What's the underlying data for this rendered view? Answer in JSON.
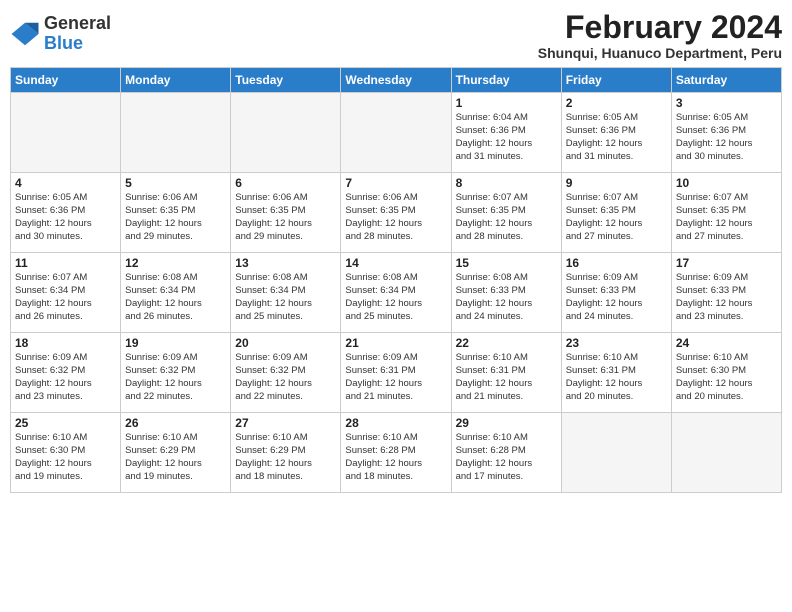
{
  "logo": {
    "general": "General",
    "blue": "Blue"
  },
  "title": {
    "month_year": "February 2024",
    "location": "Shunqui, Huanuco Department, Peru"
  },
  "headers": [
    "Sunday",
    "Monday",
    "Tuesday",
    "Wednesday",
    "Thursday",
    "Friday",
    "Saturday"
  ],
  "weeks": [
    [
      {
        "day": "",
        "lines": []
      },
      {
        "day": "",
        "lines": []
      },
      {
        "day": "",
        "lines": []
      },
      {
        "day": "",
        "lines": []
      },
      {
        "day": "1",
        "lines": [
          "Sunrise: 6:04 AM",
          "Sunset: 6:36 PM",
          "Daylight: 12 hours",
          "and 31 minutes."
        ]
      },
      {
        "day": "2",
        "lines": [
          "Sunrise: 6:05 AM",
          "Sunset: 6:36 PM",
          "Daylight: 12 hours",
          "and 31 minutes."
        ]
      },
      {
        "day": "3",
        "lines": [
          "Sunrise: 6:05 AM",
          "Sunset: 6:36 PM",
          "Daylight: 12 hours",
          "and 30 minutes."
        ]
      }
    ],
    [
      {
        "day": "4",
        "lines": [
          "Sunrise: 6:05 AM",
          "Sunset: 6:36 PM",
          "Daylight: 12 hours",
          "and 30 minutes."
        ]
      },
      {
        "day": "5",
        "lines": [
          "Sunrise: 6:06 AM",
          "Sunset: 6:35 PM",
          "Daylight: 12 hours",
          "and 29 minutes."
        ]
      },
      {
        "day": "6",
        "lines": [
          "Sunrise: 6:06 AM",
          "Sunset: 6:35 PM",
          "Daylight: 12 hours",
          "and 29 minutes."
        ]
      },
      {
        "day": "7",
        "lines": [
          "Sunrise: 6:06 AM",
          "Sunset: 6:35 PM",
          "Daylight: 12 hours",
          "and 28 minutes."
        ]
      },
      {
        "day": "8",
        "lines": [
          "Sunrise: 6:07 AM",
          "Sunset: 6:35 PM",
          "Daylight: 12 hours",
          "and 28 minutes."
        ]
      },
      {
        "day": "9",
        "lines": [
          "Sunrise: 6:07 AM",
          "Sunset: 6:35 PM",
          "Daylight: 12 hours",
          "and 27 minutes."
        ]
      },
      {
        "day": "10",
        "lines": [
          "Sunrise: 6:07 AM",
          "Sunset: 6:35 PM",
          "Daylight: 12 hours",
          "and 27 minutes."
        ]
      }
    ],
    [
      {
        "day": "11",
        "lines": [
          "Sunrise: 6:07 AM",
          "Sunset: 6:34 PM",
          "Daylight: 12 hours",
          "and 26 minutes."
        ]
      },
      {
        "day": "12",
        "lines": [
          "Sunrise: 6:08 AM",
          "Sunset: 6:34 PM",
          "Daylight: 12 hours",
          "and 26 minutes."
        ]
      },
      {
        "day": "13",
        "lines": [
          "Sunrise: 6:08 AM",
          "Sunset: 6:34 PM",
          "Daylight: 12 hours",
          "and 25 minutes."
        ]
      },
      {
        "day": "14",
        "lines": [
          "Sunrise: 6:08 AM",
          "Sunset: 6:34 PM",
          "Daylight: 12 hours",
          "and 25 minutes."
        ]
      },
      {
        "day": "15",
        "lines": [
          "Sunrise: 6:08 AM",
          "Sunset: 6:33 PM",
          "Daylight: 12 hours",
          "and 24 minutes."
        ]
      },
      {
        "day": "16",
        "lines": [
          "Sunrise: 6:09 AM",
          "Sunset: 6:33 PM",
          "Daylight: 12 hours",
          "and 24 minutes."
        ]
      },
      {
        "day": "17",
        "lines": [
          "Sunrise: 6:09 AM",
          "Sunset: 6:33 PM",
          "Daylight: 12 hours",
          "and 23 minutes."
        ]
      }
    ],
    [
      {
        "day": "18",
        "lines": [
          "Sunrise: 6:09 AM",
          "Sunset: 6:32 PM",
          "Daylight: 12 hours",
          "and 23 minutes."
        ]
      },
      {
        "day": "19",
        "lines": [
          "Sunrise: 6:09 AM",
          "Sunset: 6:32 PM",
          "Daylight: 12 hours",
          "and 22 minutes."
        ]
      },
      {
        "day": "20",
        "lines": [
          "Sunrise: 6:09 AM",
          "Sunset: 6:32 PM",
          "Daylight: 12 hours",
          "and 22 minutes."
        ]
      },
      {
        "day": "21",
        "lines": [
          "Sunrise: 6:09 AM",
          "Sunset: 6:31 PM",
          "Daylight: 12 hours",
          "and 21 minutes."
        ]
      },
      {
        "day": "22",
        "lines": [
          "Sunrise: 6:10 AM",
          "Sunset: 6:31 PM",
          "Daylight: 12 hours",
          "and 21 minutes."
        ]
      },
      {
        "day": "23",
        "lines": [
          "Sunrise: 6:10 AM",
          "Sunset: 6:31 PM",
          "Daylight: 12 hours",
          "and 20 minutes."
        ]
      },
      {
        "day": "24",
        "lines": [
          "Sunrise: 6:10 AM",
          "Sunset: 6:30 PM",
          "Daylight: 12 hours",
          "and 20 minutes."
        ]
      }
    ],
    [
      {
        "day": "25",
        "lines": [
          "Sunrise: 6:10 AM",
          "Sunset: 6:30 PM",
          "Daylight: 12 hours",
          "and 19 minutes."
        ]
      },
      {
        "day": "26",
        "lines": [
          "Sunrise: 6:10 AM",
          "Sunset: 6:29 PM",
          "Daylight: 12 hours",
          "and 19 minutes."
        ]
      },
      {
        "day": "27",
        "lines": [
          "Sunrise: 6:10 AM",
          "Sunset: 6:29 PM",
          "Daylight: 12 hours",
          "and 18 minutes."
        ]
      },
      {
        "day": "28",
        "lines": [
          "Sunrise: 6:10 AM",
          "Sunset: 6:28 PM",
          "Daylight: 12 hours",
          "and 18 minutes."
        ]
      },
      {
        "day": "29",
        "lines": [
          "Sunrise: 6:10 AM",
          "Sunset: 6:28 PM",
          "Daylight: 12 hours",
          "and 17 minutes."
        ]
      },
      {
        "day": "",
        "lines": []
      },
      {
        "day": "",
        "lines": []
      }
    ]
  ]
}
